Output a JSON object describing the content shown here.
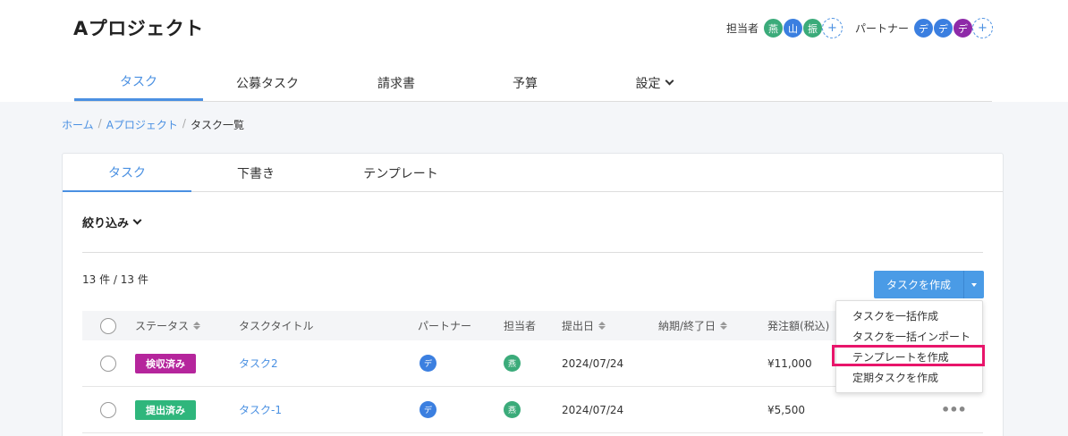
{
  "header": {
    "project_title": "Aプロジェクト",
    "assignees_label": "担当者",
    "assignees": [
      {
        "initial": "燕",
        "color": "#3bab7a"
      },
      {
        "initial": "山",
        "color": "#3b7fe0"
      },
      {
        "initial": "振",
        "color": "#3bab7a"
      }
    ],
    "partners_label": "パートナー",
    "partners": [
      {
        "initial": "デ",
        "color": "#3b7fe0"
      },
      {
        "initial": "デ",
        "color": "#3b7fe0"
      },
      {
        "initial": "デ",
        "color": "#8e2aa8"
      }
    ],
    "add_symbol": "+"
  },
  "main_tabs": [
    {
      "label": "タスク",
      "active": true
    },
    {
      "label": "公募タスク",
      "active": false
    },
    {
      "label": "請求書",
      "active": false
    },
    {
      "label": "予算",
      "active": false
    },
    {
      "label": "設定",
      "active": false
    }
  ],
  "breadcrumb": {
    "home": "ホーム",
    "project": "Aプロジェクト",
    "current": "タスク一覧",
    "separator": "/"
  },
  "sub_tabs": [
    {
      "label": "タスク",
      "active": true
    },
    {
      "label": "下書き",
      "active": false
    },
    {
      "label": "テンプレート",
      "active": false
    }
  ],
  "filter_label": "絞り込み",
  "count_text": "13 件 / 13 件",
  "create_button_label": "タスクを作成",
  "table": {
    "headers": {
      "status": "ステータス",
      "title": "タスクタイトル",
      "partner": "パートナー",
      "assignee": "担当者",
      "submit_date": "提出日",
      "due_date": "納期/終了日",
      "amount": "発注額(税込)"
    },
    "rows": [
      {
        "status": "検収済み",
        "status_color": "#b5259c",
        "title": "タスク2",
        "partner": "デ",
        "partner_color": "#3b7fe0",
        "assignee": "燕",
        "assignee_color": "#3bab7a",
        "submit_date": "2024/07/24",
        "due_date": "",
        "amount": "¥11,000",
        "more": "•••"
      },
      {
        "status": "提出済み",
        "status_color": "#2fb67c",
        "title": "タスク-1",
        "partner": "デ",
        "partner_color": "#3b7fe0",
        "assignee": "燕",
        "assignee_color": "#3bab7a",
        "submit_date": "2024/07/24",
        "due_date": "",
        "amount": "¥5,500",
        "more": "•••"
      }
    ]
  },
  "create_menu": [
    "タスクを一括作成",
    "タスクを一括インポート",
    "テンプレートを作成",
    "定期タスクを作成"
  ],
  "highlight_color": "#e8156a"
}
